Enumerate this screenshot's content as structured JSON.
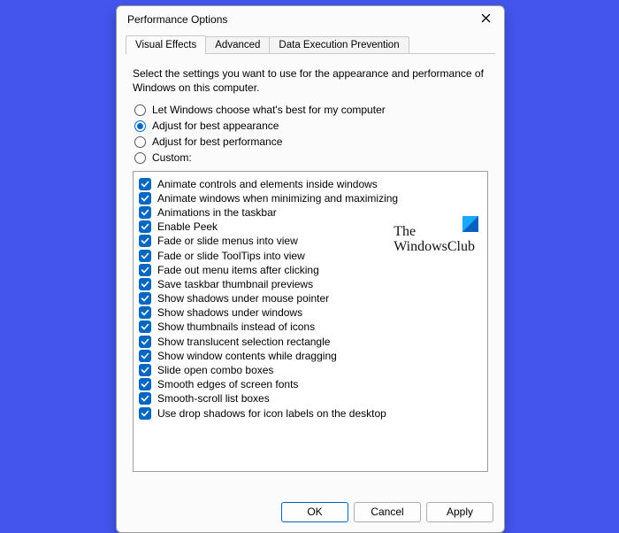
{
  "dialog": {
    "title": "Performance Options",
    "tabs": [
      {
        "label": "Visual Effects",
        "active": true
      },
      {
        "label": "Advanced",
        "active": false
      },
      {
        "label": "Data Execution Prevention",
        "active": false
      }
    ],
    "description": "Select the settings you want to use for the appearance and performance of Windows on this computer.",
    "radios": [
      {
        "label": "Let Windows choose what's best for my computer",
        "checked": false
      },
      {
        "label": "Adjust for best appearance",
        "checked": true
      },
      {
        "label": "Adjust for best performance",
        "checked": false
      },
      {
        "label": "Custom:",
        "checked": false
      }
    ],
    "options": [
      "Animate controls and elements inside windows",
      "Animate windows when minimizing and maximizing",
      "Animations in the taskbar",
      "Enable Peek",
      "Fade or slide menus into view",
      "Fade or slide ToolTips into view",
      "Fade out menu items after clicking",
      "Save taskbar thumbnail previews",
      "Show shadows under mouse pointer",
      "Show shadows under windows",
      "Show thumbnails instead of icons",
      "Show translucent selection rectangle",
      "Show window contents while dragging",
      "Slide open combo boxes",
      "Smooth edges of screen fonts",
      "Smooth-scroll list boxes",
      "Use drop shadows for icon labels on the desktop"
    ],
    "buttons": {
      "ok": "OK",
      "cancel": "Cancel",
      "apply": "Apply"
    }
  },
  "watermark": {
    "line1": "The",
    "line2": "WindowsClub"
  }
}
